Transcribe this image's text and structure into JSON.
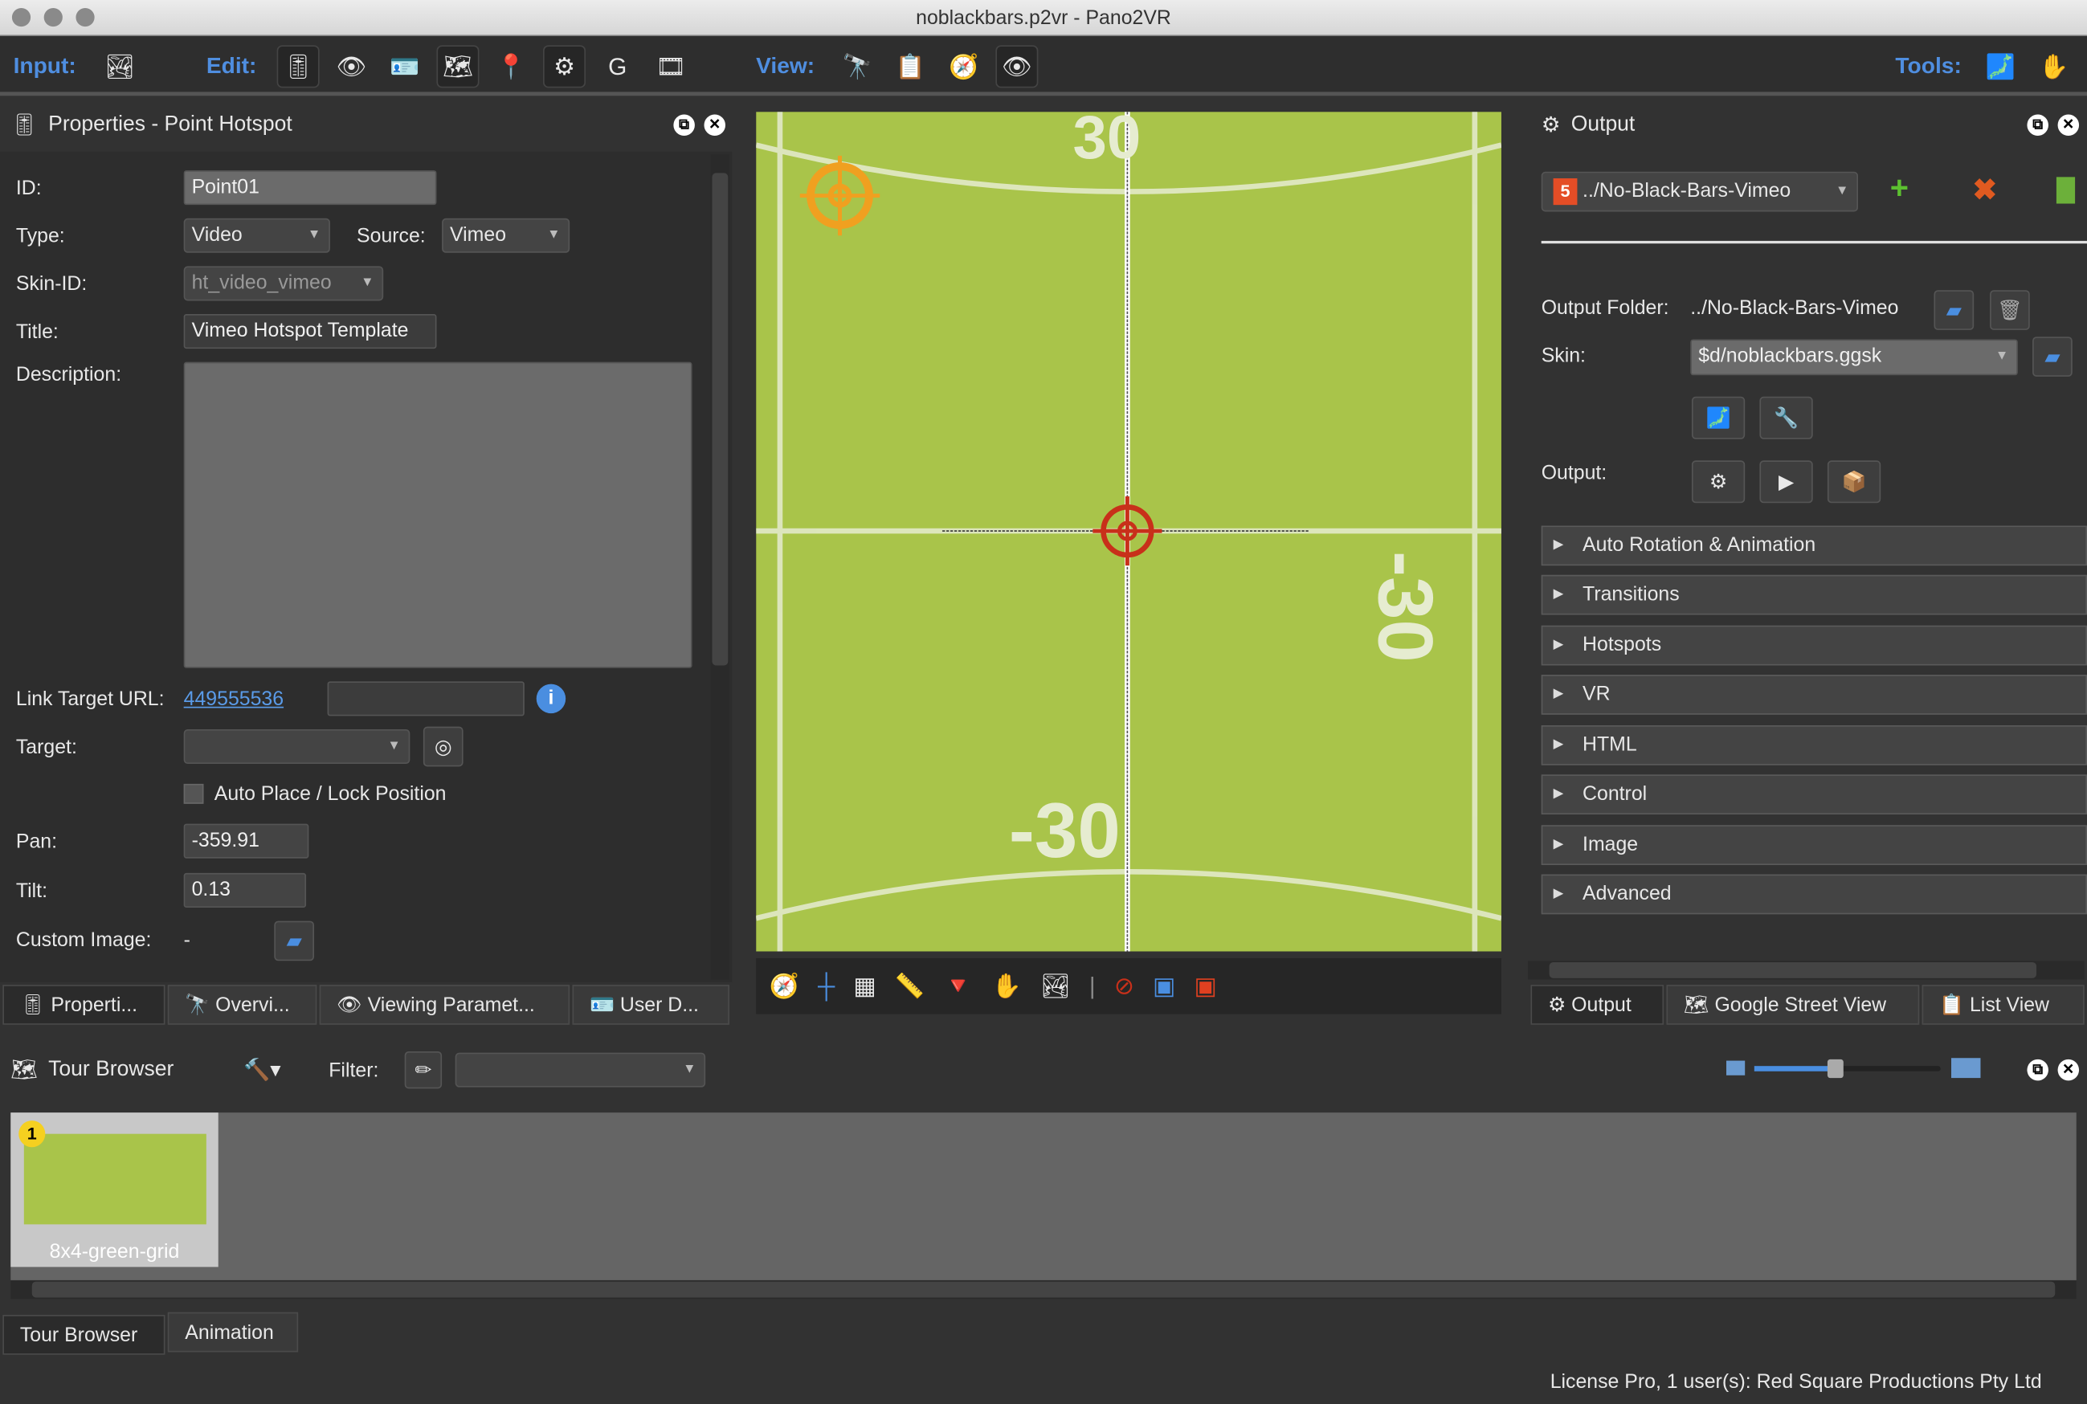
{
  "window": {
    "title": "noblackbars.p2vr - Pano2VR"
  },
  "toolbar": {
    "input_label": "Input:",
    "edit_label": "Edit:",
    "view_label": "View:",
    "tools_label": "Tools:"
  },
  "properties": {
    "title": "Properties - Point Hotspot",
    "id_label": "ID:",
    "id_value": "Point01",
    "type_label": "Type:",
    "type_value": "Video",
    "source_label": "Source:",
    "source_value": "Vimeo",
    "skin_id_label": "Skin-ID:",
    "skin_id_value": "ht_video_vimeo",
    "title_label": "Title:",
    "title_value": "Vimeo Hotspot Template",
    "description_label": "Description:",
    "description_value": "",
    "link_label": "Link Target URL:",
    "link_value": "449555536",
    "target_label": "Target:",
    "target_value": "",
    "auto_place_label": "Auto Place / Lock Position",
    "auto_place_checked": false,
    "pan_label": "Pan:",
    "pan_value": "-359.91",
    "tilt_label": "Tilt:",
    "tilt_value": "0.13",
    "custom_image_label": "Custom Image:",
    "custom_image_value": "-"
  },
  "left_tabs": [
    "Properti...",
    "Overvi...",
    "Viewing Paramet...",
    "User D..."
  ],
  "viewer": {
    "grid_labels": [
      "30",
      "-30",
      "-30"
    ],
    "background": "#a9c44a"
  },
  "output": {
    "title": "Output",
    "format_value": "../No-Black-Bars-Vimeo",
    "folder_label": "Output Folder:",
    "folder_value": "../No-Black-Bars-Vimeo",
    "skin_label": "Skin:",
    "skin_value": "$d/noblackbars.ggsk",
    "output_label": "Output:",
    "sections": [
      "Auto Rotation & Animation",
      "Transitions",
      "Hotspots",
      "VR",
      "HTML",
      "Control",
      "Image",
      "Advanced"
    ]
  },
  "right_tabs": [
    "Output",
    "Google Street View",
    "List View"
  ],
  "tour": {
    "title": "Tour Browser",
    "filter_label": "Filter:",
    "filter_value": "",
    "items": [
      {
        "number": "1",
        "label": "8x4-green-grid"
      }
    ]
  },
  "bottom_tabs": [
    "Tour Browser",
    "Animation"
  ],
  "status": {
    "license": "License Pro, 1 user(s): Red Square Productions Pty Ltd"
  }
}
